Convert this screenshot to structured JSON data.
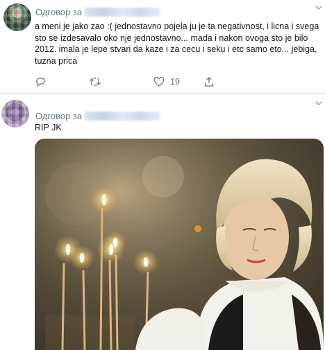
{
  "tweets": [
    {
      "reply_label": "Одговор за",
      "text": "a meni je jako zao :( jednostavno pojela ju je ta negativnost, i licna i svega sto se izdesavalo oko nje jednostavno... mada i nakon ovoga sto je bilo 2012. imala je lepe stvari da kaze i za cecu i seku i etc samo eto... jebiga, tuzna prica",
      "like_count": "19",
      "icons": [
        "reply-icon",
        "retweet-icon",
        "like-icon",
        "share-icon",
        "chevron-down-icon"
      ]
    },
    {
      "reply_label": "Одговор за",
      "text": "RIP JK",
      "media": "photo"
    }
  ],
  "colors": {
    "text": "#14171a",
    "secondary": "#657786",
    "divider": "#e6ecf0"
  }
}
